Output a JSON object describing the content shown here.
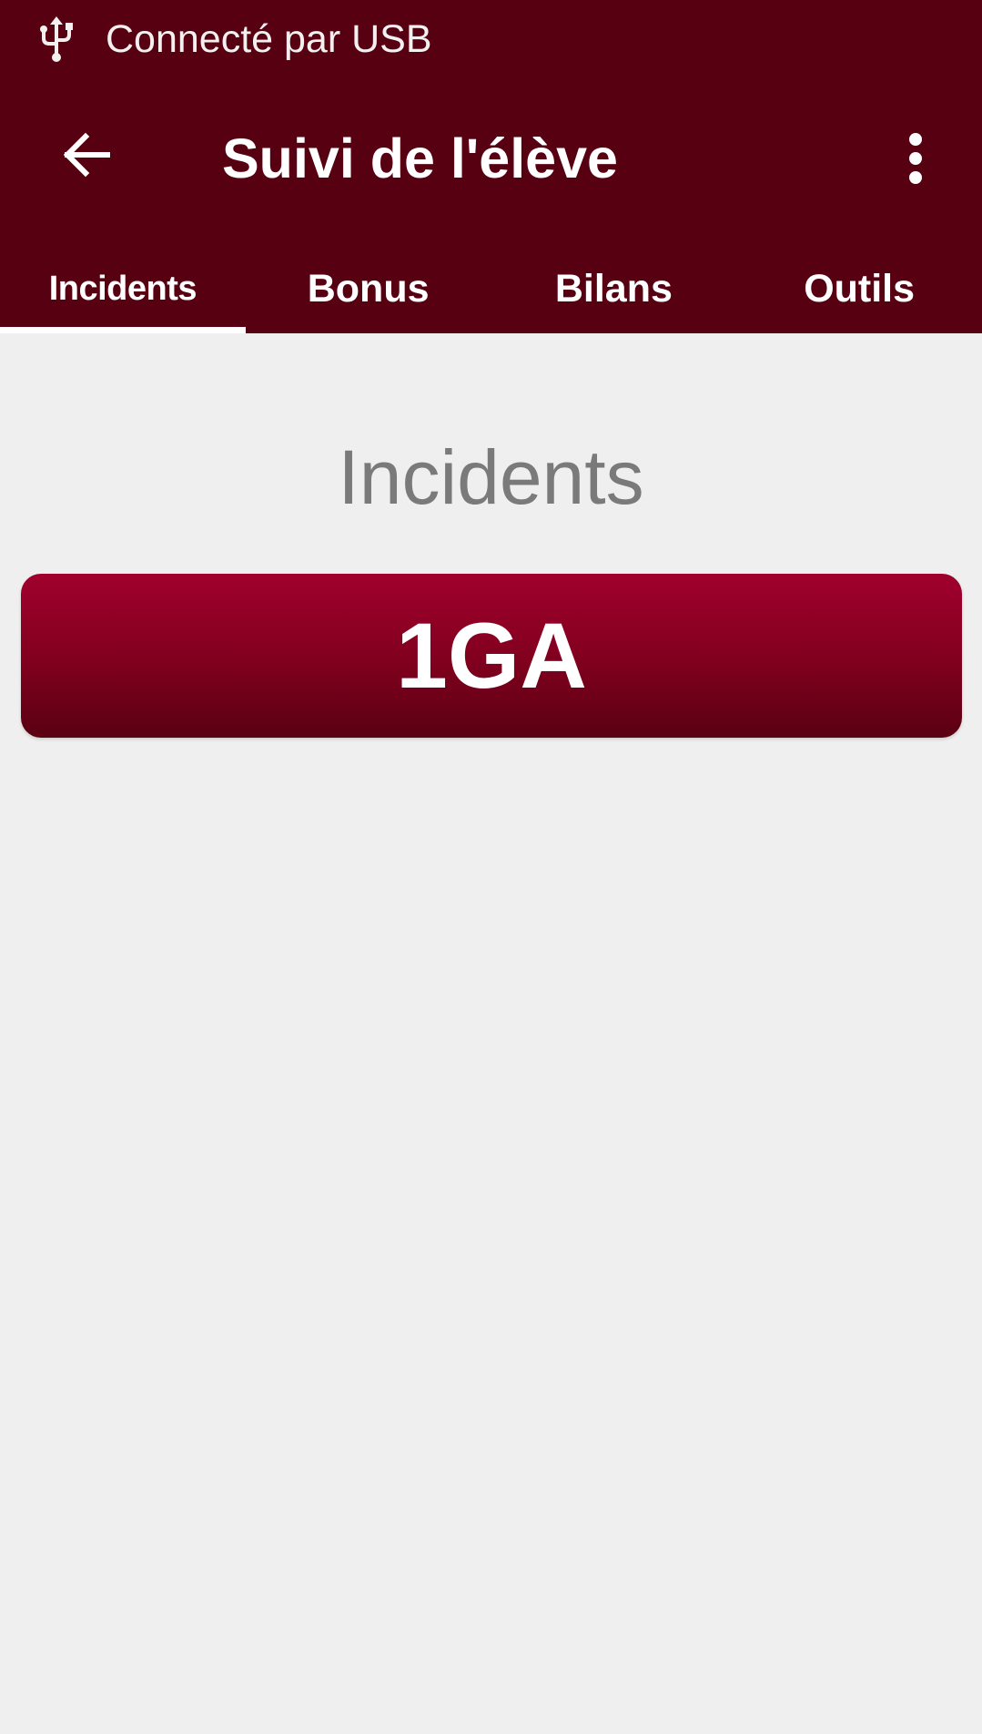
{
  "status_bar": {
    "icon": "usb-icon",
    "text": "Connecté par USB"
  },
  "app_bar": {
    "back_icon": "arrow-back-icon",
    "title": "Suivi de l'élève",
    "overflow_icon": "more-vertical-icon"
  },
  "tabs": [
    {
      "label": "Incidents",
      "active": true
    },
    {
      "label": "Bonus",
      "active": false
    },
    {
      "label": "Bilans",
      "active": false
    },
    {
      "label": "Outils",
      "active": false
    }
  ],
  "content": {
    "heading": "Incidents",
    "classes": [
      {
        "label": "1GA"
      }
    ]
  },
  "colors": {
    "primary": "#560011",
    "button_top": "#a0002d",
    "button_bottom": "#5a0012",
    "background": "#efefef",
    "heading_text": "#7a7a7a"
  }
}
